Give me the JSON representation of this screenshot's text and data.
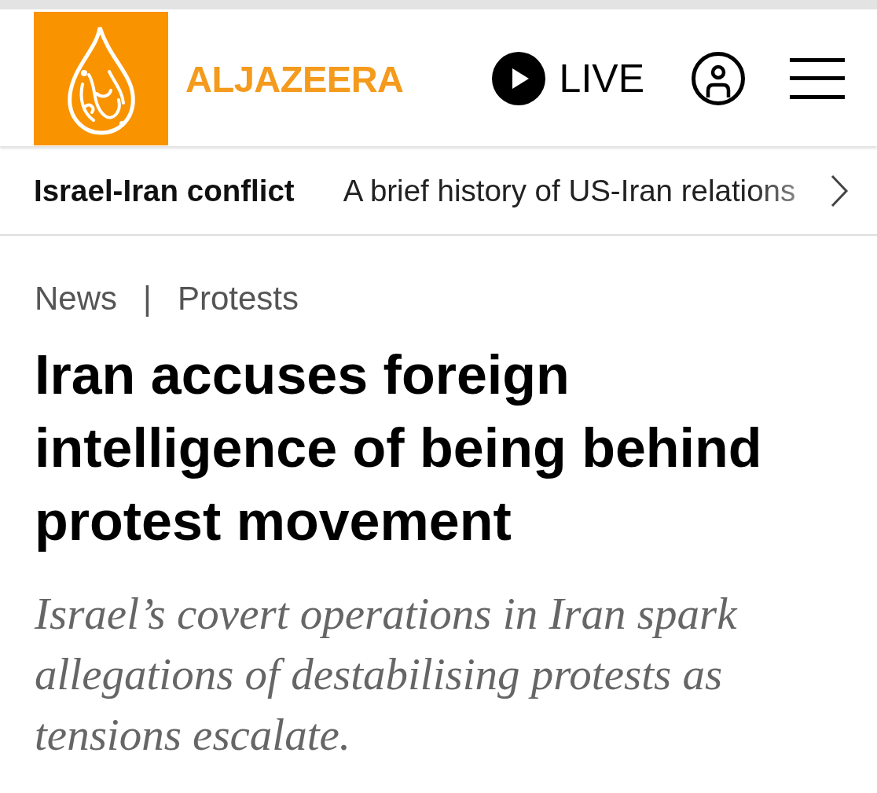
{
  "header": {
    "wordmark": "ALJAZEERA",
    "live": {
      "label": "LIVE"
    }
  },
  "topic_bar": {
    "topic": "Israel-Iran conflict",
    "links": [
      "A brief history of US-Iran relations"
    ]
  },
  "article": {
    "breadcrumb": [
      "News",
      "Protests"
    ],
    "separator": "|",
    "headline": "Iran accuses foreign intelligence of being behind protest movement",
    "standfirst": "Israel’s covert operations in Iran spark allegations of destabilising protests as tensions escalate."
  }
}
